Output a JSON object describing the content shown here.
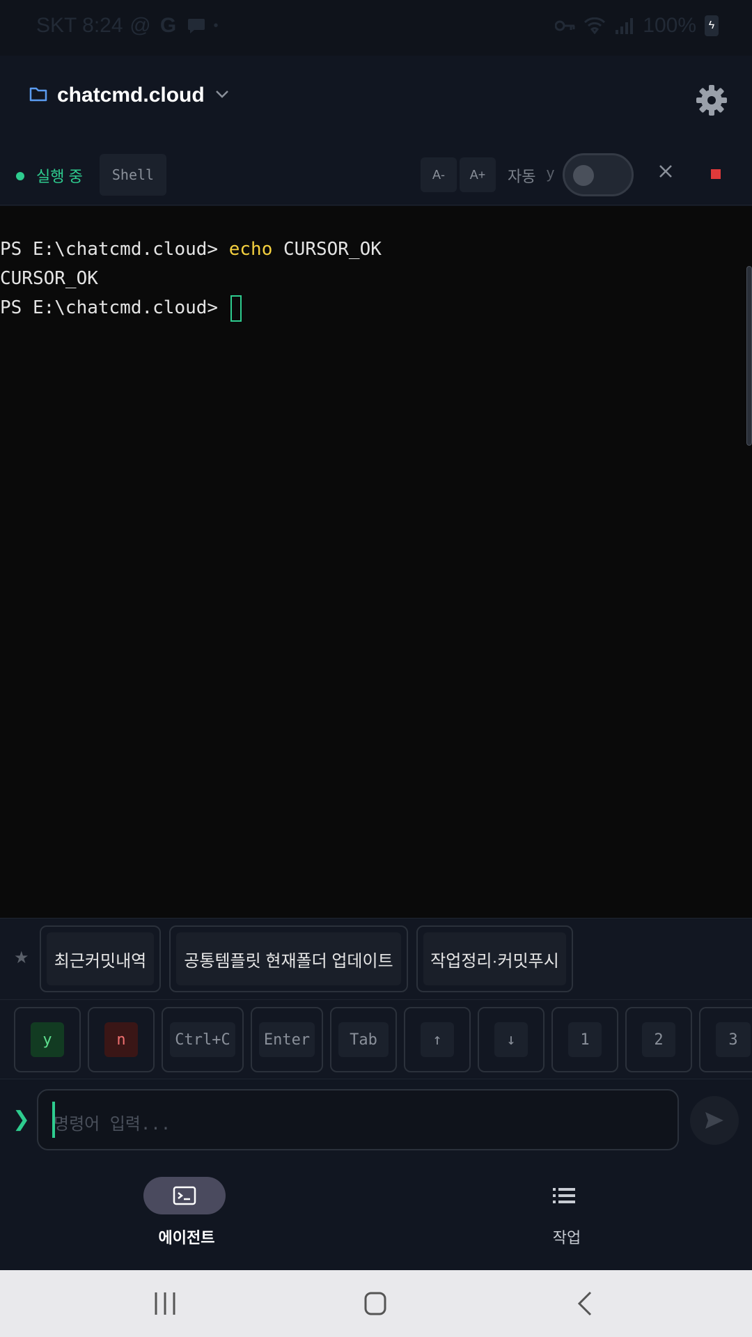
{
  "status_bar": {
    "carrier_time": "SKT 8:24",
    "battery": "100%"
  },
  "header": {
    "project_name": "chatcmd.cloud"
  },
  "session": {
    "status": "실행 중",
    "shell_label": "Shell",
    "font_decrease": "A-",
    "font_increase": "A+",
    "auto_label": "자동",
    "auto_key": "y",
    "auto_enabled": false
  },
  "terminal": {
    "line1_prompt": "PS E:\\chatcmd.cloud> ",
    "line1_cmd": "echo",
    "line1_arg": " CURSOR_OK",
    "line2": "CURSOR_OK",
    "line3_prompt": "PS E:\\chatcmd.cloud> "
  },
  "quick_commands": [
    {
      "label": "최근커밋내역"
    },
    {
      "label": "공통템플릿 현재폴더 업데이트"
    },
    {
      "label": "작업정리·커밋푸시"
    }
  ],
  "keys": [
    "y",
    "n",
    "Ctrl+C",
    "Enter",
    "Tab",
    "↑",
    "↓",
    "1",
    "2",
    "3"
  ],
  "input": {
    "placeholder": "명령어 입력..."
  },
  "bottom_nav": {
    "agent": "에이전트",
    "tasks": "작업"
  },
  "colors": {
    "accent_green": "#2ecc8f",
    "stop_red": "#e03a3a",
    "keyword_yellow": "#f4d03f",
    "folder_blue": "#5b9bf0"
  }
}
